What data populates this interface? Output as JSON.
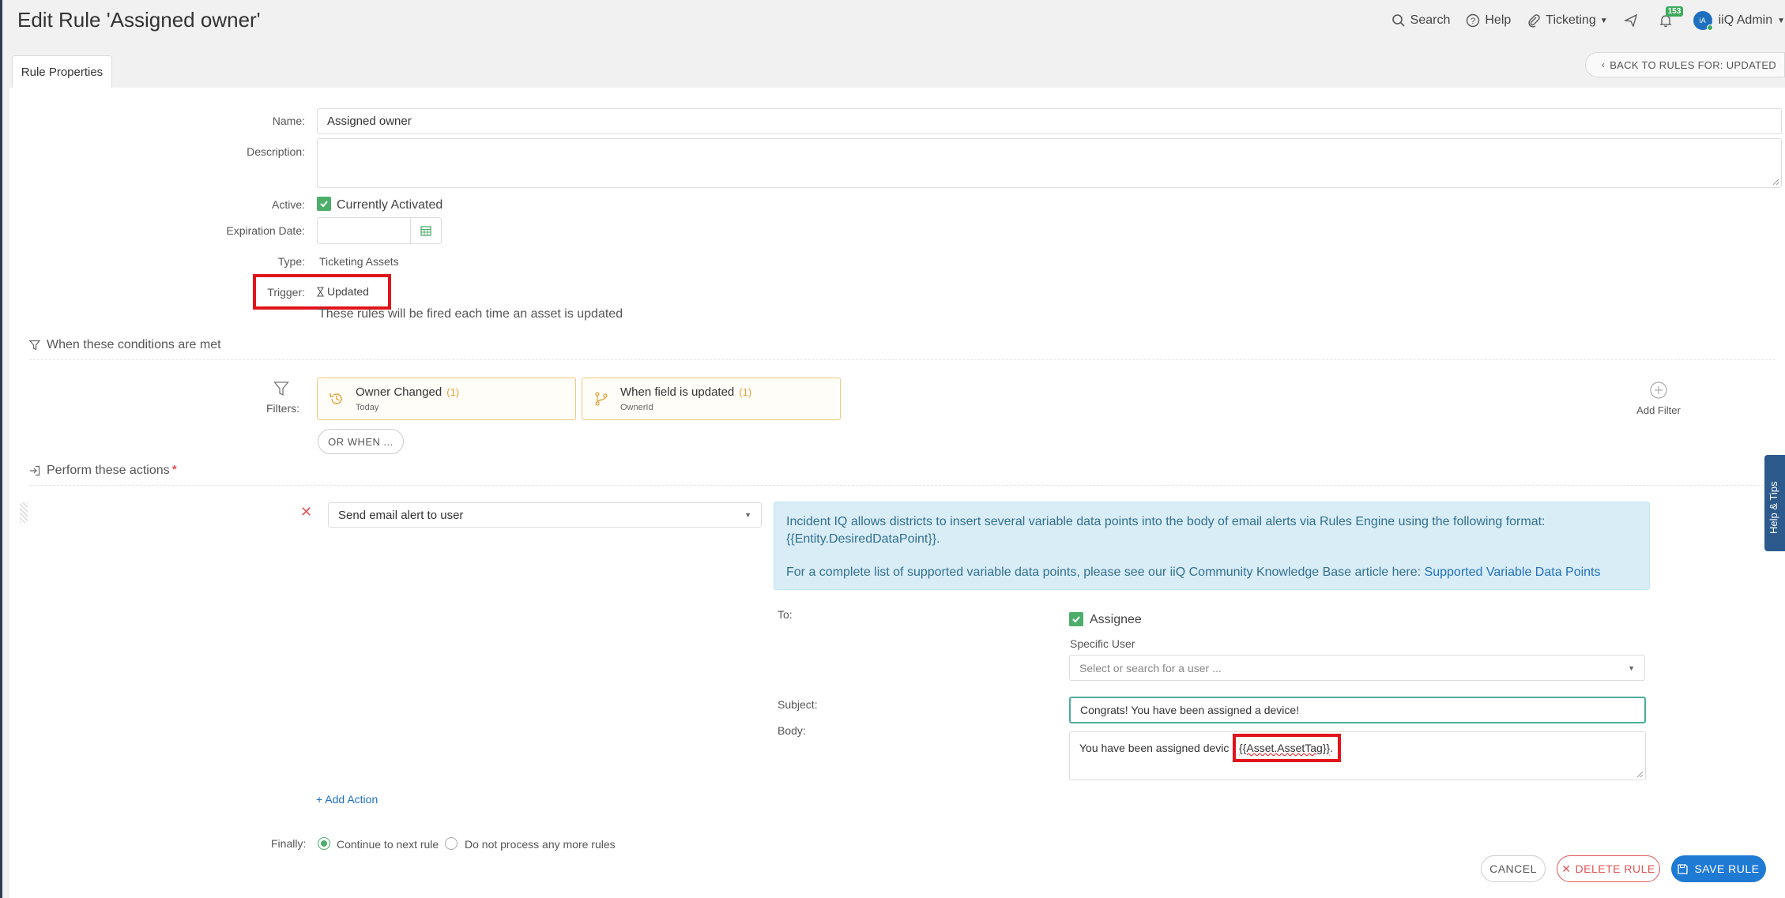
{
  "page": {
    "title": "Edit Rule 'Assigned owner'"
  },
  "topnav": {
    "search_label": "Search",
    "help_label": "Help",
    "ticketing_label": "Ticketing",
    "notification_count": "153",
    "avatar_initials": "iA",
    "user_name": "iiQ Admin"
  },
  "tabs": {
    "rule_properties": "Rule Properties"
  },
  "back_button": "BACK TO RULES FOR: UPDATED",
  "form": {
    "name_label": "Name:",
    "name_value": "Assigned owner",
    "description_label": "Description:",
    "description_value": "",
    "active_label": "Active:",
    "active_text": "Currently Activated",
    "expiration_label": "Expiration Date:",
    "expiration_value": "",
    "type_label": "Type:",
    "type_value": "Ticketing Assets",
    "trigger_label": "Trigger:",
    "trigger_value": "Updated",
    "trigger_note": "These rules will be fired each time an asset is updated"
  },
  "conditions": {
    "heading": "When these conditions are met",
    "filters_label": "Filters:",
    "filters": [
      {
        "title": "Owner Changed",
        "count": "(1)",
        "sub": "Today"
      },
      {
        "title": "When field is updated",
        "count": "(1)",
        "sub": "OwnerId"
      }
    ],
    "or_when": "OR WHEN ...",
    "add_filter": "Add Filter"
  },
  "actions": {
    "heading": "Perform these actions",
    "required_mark": "*",
    "action_select": "Send email alert to user",
    "info_line1": "Incident IQ allows districts to insert several variable data points into the body of email alerts via Rules Engine using the following format:",
    "info_line2": "{{Entity.DesiredDataPoint}}.",
    "info_line3": "For a complete list of supported variable data points, please see our iiQ Community Knowledge Base article here:",
    "info_link": "Supported Variable Data Points",
    "to_label": "To:",
    "assignee_label": "Assignee",
    "specific_user_label": "Specific User",
    "specific_user_placeholder": "Select or search for a user ...",
    "subject_label": "Subject:",
    "subject_value": "Congrats! You have been assigned a device!",
    "body_label": "Body:",
    "body_prefix": "You have been assigned devic",
    "body_token": "{{Asset.AssetTag}}",
    "body_suffix": ".",
    "add_action": "+ Add Action"
  },
  "finally": {
    "label": "Finally:",
    "option1": "Continue to next rule",
    "option2": "Do not process any more rules"
  },
  "buttons": {
    "cancel": "CANCEL",
    "delete": "DELETE RULE",
    "save": "SAVE RULE"
  },
  "help_tab": "Help & Tips",
  "colors": {
    "accent_green": "#4cae6a",
    "highlight_red": "#e1141b",
    "save_blue": "#1f7ad4",
    "delete_red": "#e05656"
  }
}
